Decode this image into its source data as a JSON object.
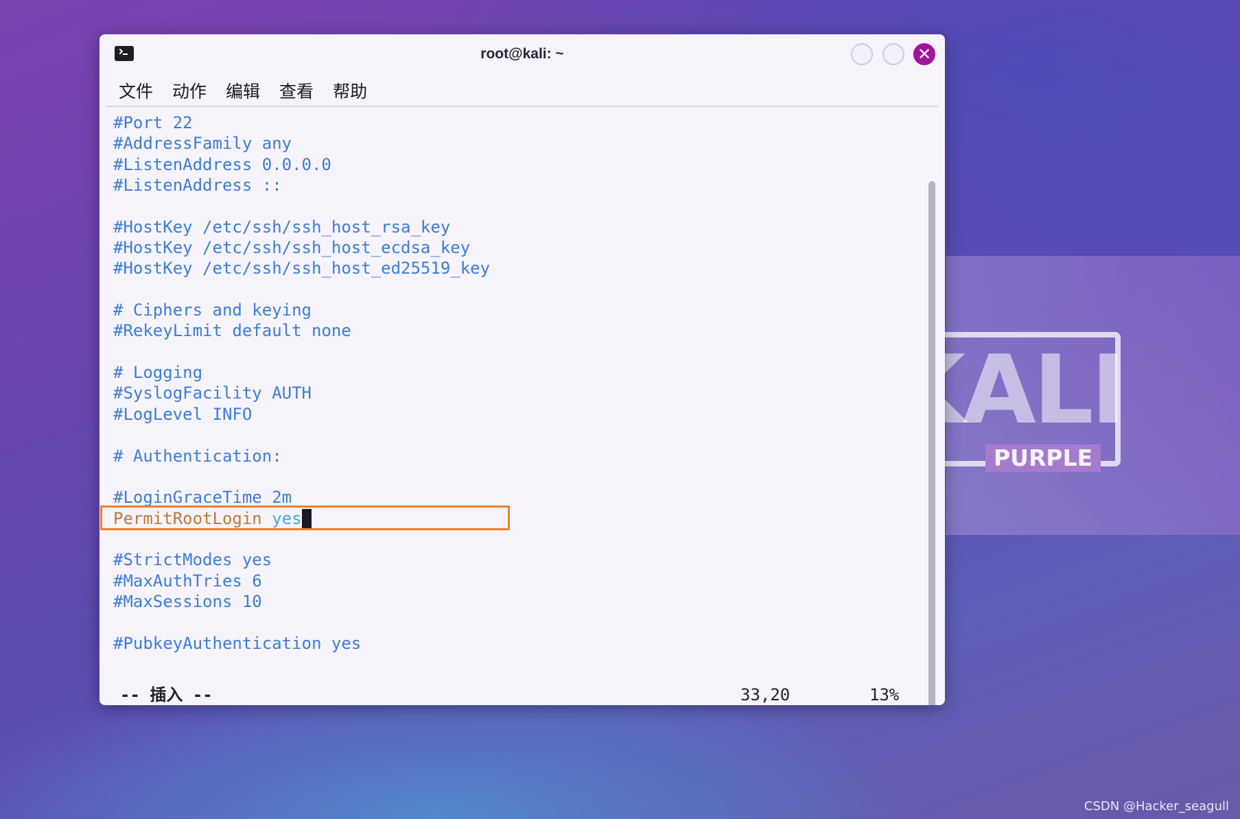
{
  "desktop": {
    "logo_text": "KALI",
    "logo_sub": "PURPLE",
    "watermark": "CSDN @Hacker_seagull"
  },
  "window": {
    "title": "root@kali: ~",
    "close_glyph": "✕",
    "icons": [
      "terminal-icon",
      "minimize-icon",
      "maximize-icon",
      "close-icon"
    ]
  },
  "menu": [
    "文件",
    "动作",
    "编辑",
    "查看",
    "帮助"
  ],
  "editor": {
    "lines": [
      "#Port 22",
      "#AddressFamily any",
      "#ListenAddress 0.0.0.0",
      "#ListenAddress ::",
      "",
      "#HostKey /etc/ssh/ssh_host_rsa_key",
      "#HostKey /etc/ssh/ssh_host_ecdsa_key",
      "#HostKey /etc/ssh/ssh_host_ed25519_key",
      "",
      "# Ciphers and keying",
      "#RekeyLimit default none",
      "",
      "# Logging",
      "#SyslogFacility AUTH",
      "#LogLevel INFO",
      "",
      "# Authentication:",
      "",
      "#LoginGraceTime 2m",
      "",
      "#StrictModes yes",
      "#MaxAuthTries 6",
      "#MaxSessions 10",
      "",
      "#PubkeyAuthentication yes"
    ],
    "active_line": {
      "index": 19,
      "key": "PermitRootLogin",
      "value": "yes"
    },
    "status": {
      "mode": "-- 插入 --",
      "position": "33,20",
      "percent": "13%"
    }
  },
  "colors": {
    "comment": "#3b7dd8",
    "active_key": "#c0793a",
    "active_value": "#4aa6df",
    "highlight_border": "#f07f2c",
    "close_button": "#a0159b"
  }
}
